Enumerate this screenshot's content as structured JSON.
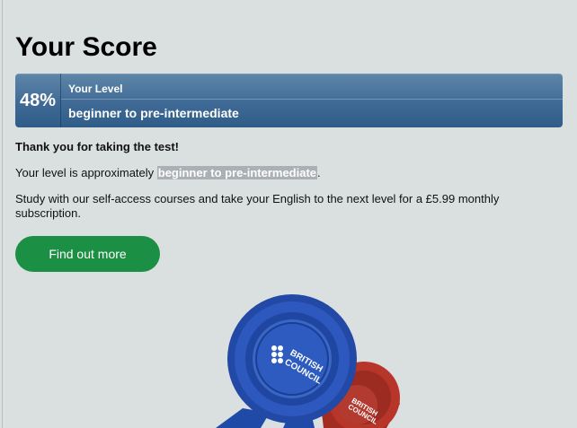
{
  "page": {
    "title": "Your Score"
  },
  "score": {
    "percent": "48%",
    "level_label": "Your Level",
    "level_value": "beginner to pre-intermediate"
  },
  "result": {
    "thanks": "Thank you for taking the test!",
    "level_prefix": "Your level is approximately ",
    "level_highlight": "beginner to pre-intermediate",
    "level_suffix": ".",
    "study_text": "Study with our self-access courses and take your English to the next level for a £5.99 monthly subscription."
  },
  "cta": {
    "label": "Find out more"
  },
  "badge": {
    "logo_text_1": "BRITISH",
    "logo_text_2": "COUNCIL",
    "back_logo_text_1": "BRITISH",
    "back_logo_text_2": "COUNCIL"
  },
  "colors": {
    "background": "#dadfe0",
    "score_bar": "#3f6a95",
    "button": "#1b8f43",
    "rosette_blue": "#2b57b8",
    "rosette_red": "#b8352a"
  }
}
